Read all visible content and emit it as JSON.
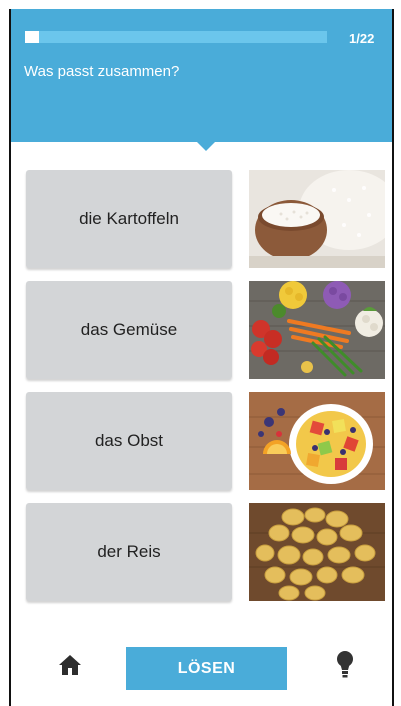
{
  "progress": {
    "current": 1,
    "total": 22,
    "label": "1/22",
    "fraction": 0.045
  },
  "question": "Was passt zusammen?",
  "words": [
    {
      "label": "die Kartoffeln"
    },
    {
      "label": "das Gemüse"
    },
    {
      "label": "das Obst"
    },
    {
      "label": "der Reis"
    }
  ],
  "images": [
    {
      "icon": "rice-photo"
    },
    {
      "icon": "vegetables-photo"
    },
    {
      "icon": "fruit-bowl-photo"
    },
    {
      "icon": "potatoes-photo"
    }
  ],
  "footer": {
    "solve_label": "LÖSEN",
    "home_icon": "home-icon",
    "hint_icon": "lightbulb-icon"
  },
  "colors": {
    "accent": "#4aacd9",
    "card": "#d3d5d7"
  }
}
